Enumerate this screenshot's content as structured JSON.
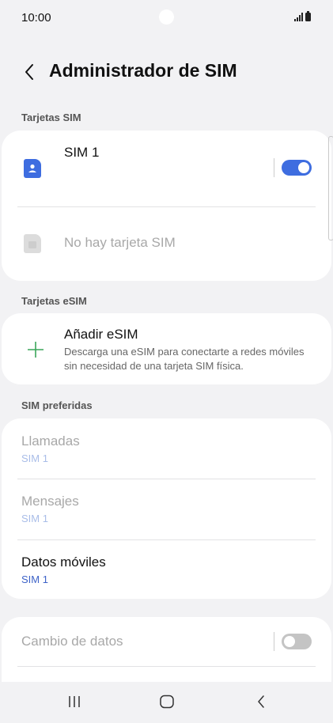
{
  "status": {
    "time": "10:00"
  },
  "header": {
    "title": "Administrador de SIM"
  },
  "sections": {
    "sim_cards": "Tarjetas SIM",
    "esim_cards": "Tarjetas eSIM",
    "preferred": "SIM preferidas"
  },
  "sim_cards": {
    "sim1": {
      "label": "SIM 1",
      "enabled": true
    },
    "empty_slot": {
      "label": "No hay tarjeta SIM"
    }
  },
  "esim": {
    "add_title": "Añadir eSIM",
    "add_description": "Descarga una eSIM para conectarte a redes móviles sin necesidad de una tarjeta SIM física."
  },
  "preferred": {
    "calls": {
      "label": "Llamadas",
      "value": "SIM 1"
    },
    "messages": {
      "label": "Mensajes",
      "value": "SIM 1"
    },
    "mobile_data": {
      "label": "Datos móviles",
      "value": "SIM 1"
    }
  },
  "data_switch": {
    "label": "Cambio de datos",
    "enabled": false
  },
  "colors": {
    "accent": "#3e6de0",
    "toggle_off": "#c4c4c4",
    "esim_plus": "#3aa65a"
  },
  "icons": {
    "back": "chevron-left-icon",
    "sim": "sim-card-icon",
    "add": "plus-icon",
    "nav_recent": "recent-apps-icon",
    "nav_home": "home-icon",
    "nav_back": "back-icon"
  }
}
